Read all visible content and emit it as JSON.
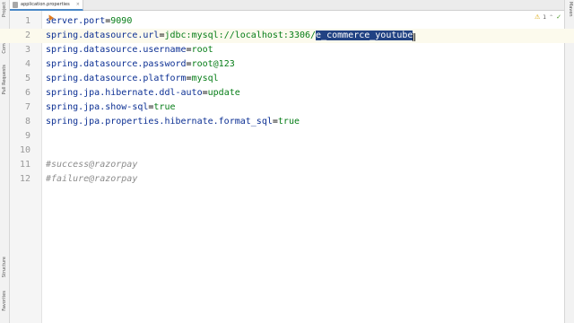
{
  "tabs": [
    {
      "label": "application.properties",
      "close": "×"
    }
  ],
  "left_toolwindows": [
    "Project",
    "Commit",
    "Pull Requests",
    "Structure",
    "Favorites"
  ],
  "right_toolwindows": [
    "Maven"
  ],
  "inspections": {
    "warning_count": "1",
    "warning_symbol": "⚠",
    "nav_symbol": "⌃",
    "ok_symbol": "✓"
  },
  "editor": {
    "current_line": 2,
    "selected_text": "e_commerce_youtube",
    "lines": [
      {
        "num": "1",
        "key": "server.port",
        "sep": "=",
        "value": "9090"
      },
      {
        "num": "2",
        "key": "spring.datasource.url",
        "sep": "=",
        "value": "jdbc:mysql://localhost:3306/",
        "selected": "e_commerce_youtube"
      },
      {
        "num": "3",
        "key": "spring.datasource.username",
        "sep": "=",
        "value": "root"
      },
      {
        "num": "4",
        "key": "spring.datasource.password",
        "sep": "=",
        "value": "root@123"
      },
      {
        "num": "5",
        "key": "spring.datasource.platform",
        "sep": "=",
        "value": "mysql"
      },
      {
        "num": "6",
        "key": "spring.jpa.hibernate.ddl-auto",
        "sep": "=",
        "value": "update"
      },
      {
        "num": "7",
        "key": "spring.jpa.show-sql",
        "sep": "=",
        "value": "true"
      },
      {
        "num": "8",
        "key": "spring.jpa.properties.hibernate.format_sql",
        "sep": "=",
        "value": "true"
      },
      {
        "num": "9"
      },
      {
        "num": "10"
      },
      {
        "num": "11",
        "comment": "#success@razorpay"
      },
      {
        "num": "12",
        "comment": "#failure@razorpay"
      }
    ]
  }
}
